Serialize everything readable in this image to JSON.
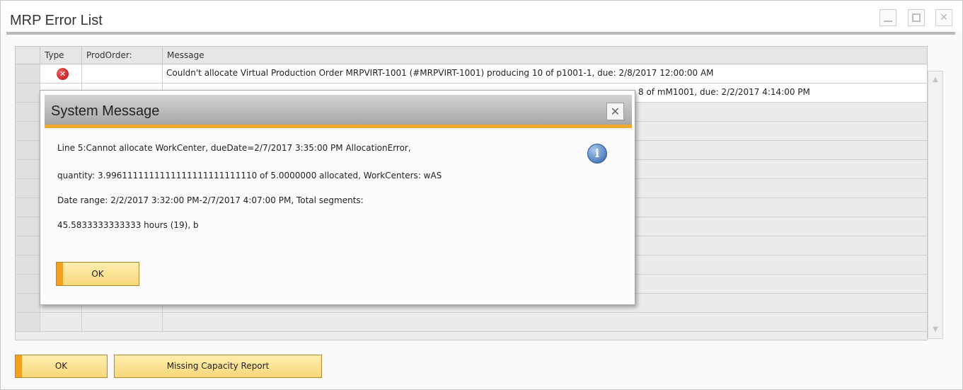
{
  "window": {
    "title": "MRP Error List",
    "close_glyph": "✕"
  },
  "grid": {
    "columns": [
      "Type",
      "ProdOrder:",
      "Message"
    ],
    "rows": [
      {
        "type_icon": "error-icon",
        "prod_order": "",
        "message": "Couldn't allocate Virtual Production Order MRPVIRT-1001 (#MRPVIRT-1001) producing 10 of p1001-1, due: 2/8/2017 12:00:00 AM"
      },
      {
        "type_icon": "",
        "prod_order": "",
        "message": "8 of mM1001, due: 2/2/2017 4:14:00 PM"
      }
    ]
  },
  "buttons": {
    "ok": "OK",
    "missing_capacity": "Missing Capacity Report"
  },
  "dialog": {
    "title": "System Message",
    "close_glyph": "✕",
    "lines": [
      "Line 5:Cannot allocate WorkCenter, dueDate=2/7/2017 3:35:00 PM AllocationError,",
      "quantity: 3.9961111111111111111111111110 of 5.0000000 allocated, WorkCenters: wAS",
      "Date range: 2/2/2017 3:32:00 PM-2/7/2017 4:07:00 PM, Total segments:",
      "45.5833333333333 hours (19), b"
    ],
    "info_glyph": "i",
    "ok_label": "OK"
  },
  "colors": {
    "accent": "#f0a82a",
    "button_fill": "#f7d77a",
    "error_red": "#c41a1a",
    "info_blue": "#2e62a8"
  }
}
